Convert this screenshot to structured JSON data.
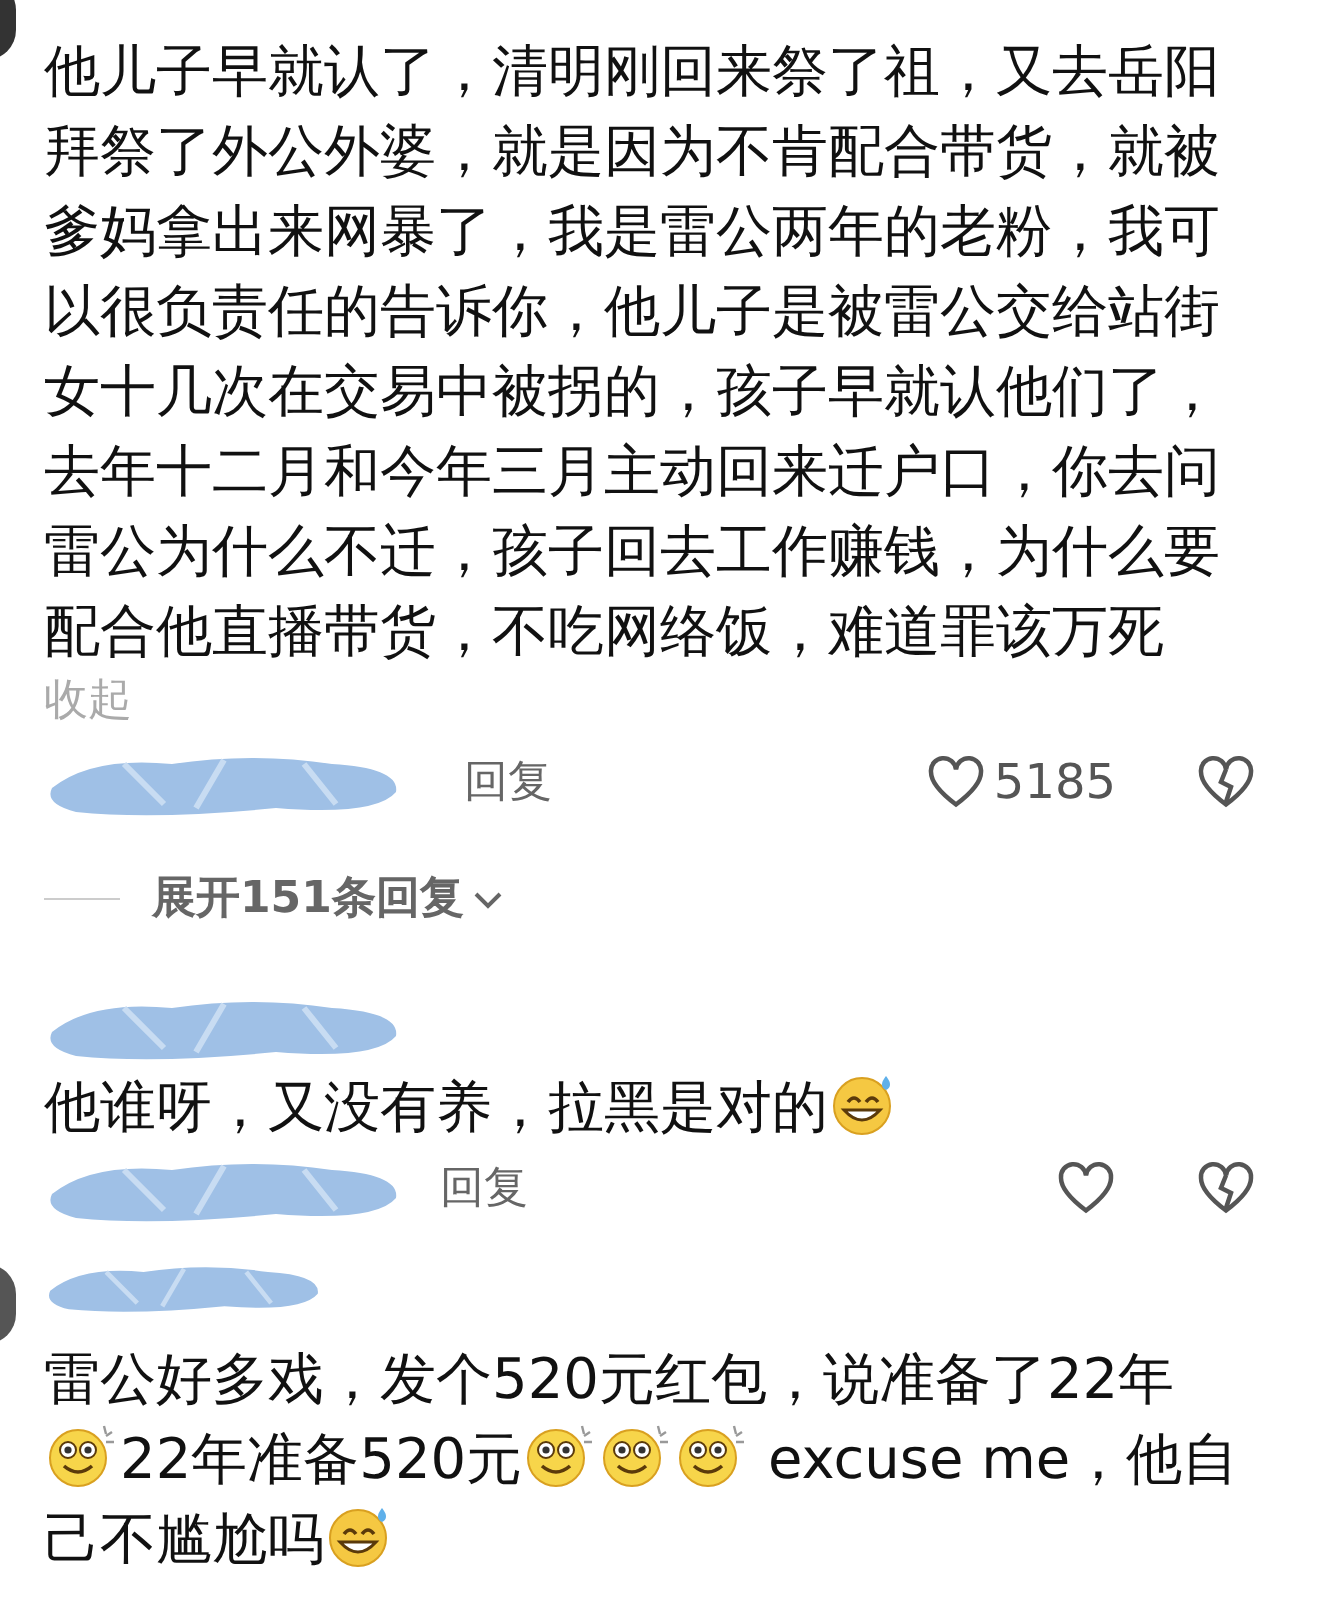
{
  "comments": [
    {
      "body": [
        {
          "kind": "text",
          "text": "他儿子早就认了，清明刚回来祭了祖，又去岳阳拜祭了外公外婆，就是因为不肯配合带货，就被爹妈拿出来网暴了，我是雷公两年的老粉，我可以很负责任的告诉你，他儿子是被雷公交给站街女十几次在交易中被拐的，孩子早就认他们了，去年十二月和今年三月主动回来迁户口，你去问雷公为什么不迁，孩子回去工作赚钱，为什么要配合他直播带货，不吃网络饭，难道罪该万死"
        }
      ],
      "collapse": "收起",
      "reply": "回复",
      "likes": "5185",
      "expand": "展开151条回复"
    },
    {
      "body": [
        {
          "kind": "text",
          "text": "他谁呀，又没有养，拉黑是对的"
        },
        {
          "kind": "grin_sweat"
        }
      ],
      "reply": "回复"
    },
    {
      "body": [
        {
          "kind": "text",
          "text": "雷公好多戏，发个520元红包，说准备了22年"
        },
        {
          "kind": "dizzy_smile"
        },
        {
          "kind": "text",
          "text": "22年准备520元"
        },
        {
          "kind": "dizzy_smile"
        },
        {
          "kind": "dizzy_smile"
        },
        {
          "kind": "dizzy_smile"
        },
        {
          "kind": "text",
          "text": " excuse me，他自己不尴尬吗"
        },
        {
          "kind": "grin_sweat"
        }
      ]
    }
  ]
}
